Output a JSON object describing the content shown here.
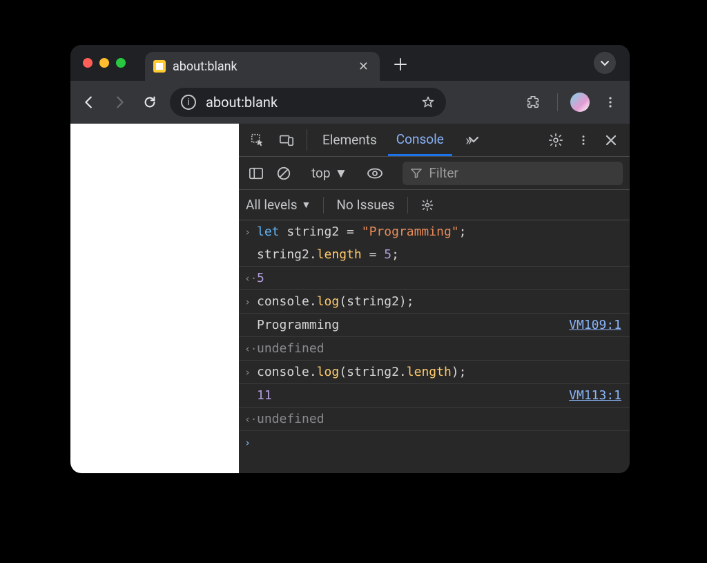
{
  "tab": {
    "title": "about:blank"
  },
  "omnibox": {
    "address": "about:blank"
  },
  "devtools": {
    "tabs": {
      "elements": "Elements",
      "console": "Console"
    }
  },
  "console_toolbar": {
    "context": "top",
    "filter_placeholder": "Filter",
    "levels": "All levels",
    "issues": "No Issues"
  },
  "rows": [
    {
      "kind": "input",
      "tokens": [
        {
          "t": "let ",
          "c": "tok-keyword2"
        },
        {
          "t": "string2",
          "c": "tok-ident"
        },
        {
          "t": " = ",
          "c": "tok-assign"
        },
        {
          "t": "\"Programming\"",
          "c": "tok-str"
        },
        {
          "t": ";",
          "c": "tok-punc"
        }
      ]
    },
    {
      "kind": "input-cont",
      "tokens": [
        {
          "t": "string2",
          "c": "tok-ident"
        },
        {
          "t": ".",
          "c": "tok-punc"
        },
        {
          "t": "length",
          "c": "tok-method"
        },
        {
          "t": " = ",
          "c": "tok-assign"
        },
        {
          "t": "5",
          "c": "tok-num"
        },
        {
          "t": ";",
          "c": "tok-punc"
        }
      ]
    },
    {
      "kind": "output",
      "tokens": [
        {
          "t": "5",
          "c": "tok-num"
        }
      ]
    },
    {
      "kind": "input",
      "tokens": [
        {
          "t": "console",
          "c": "tok-ident"
        },
        {
          "t": ".",
          "c": "tok-punc"
        },
        {
          "t": "log",
          "c": "tok-method"
        },
        {
          "t": "(",
          "c": "tok-punc"
        },
        {
          "t": "string2",
          "c": "tok-ident"
        },
        {
          "t": ")",
          "c": "tok-punc"
        },
        {
          "t": ";",
          "c": "tok-punc"
        }
      ]
    },
    {
      "kind": "log",
      "tokens": [
        {
          "t": "Programming",
          "c": "tok-ident"
        }
      ],
      "src": "VM109:1"
    },
    {
      "kind": "output",
      "tokens": [
        {
          "t": "undefined",
          "c": "tok-undef"
        }
      ]
    },
    {
      "kind": "input",
      "tokens": [
        {
          "t": "console",
          "c": "tok-ident"
        },
        {
          "t": ".",
          "c": "tok-punc"
        },
        {
          "t": "log",
          "c": "tok-method"
        },
        {
          "t": "(",
          "c": "tok-punc"
        },
        {
          "t": "string2",
          "c": "tok-ident"
        },
        {
          "t": ".",
          "c": "tok-punc"
        },
        {
          "t": "length",
          "c": "tok-method"
        },
        {
          "t": ")",
          "c": "tok-punc"
        },
        {
          "t": ";",
          "c": "tok-punc"
        }
      ]
    },
    {
      "kind": "log",
      "tokens": [
        {
          "t": "11",
          "c": "tok-num"
        }
      ],
      "src": "VM113:1"
    },
    {
      "kind": "output",
      "tokens": [
        {
          "t": "undefined",
          "c": "tok-undef"
        }
      ]
    }
  ]
}
